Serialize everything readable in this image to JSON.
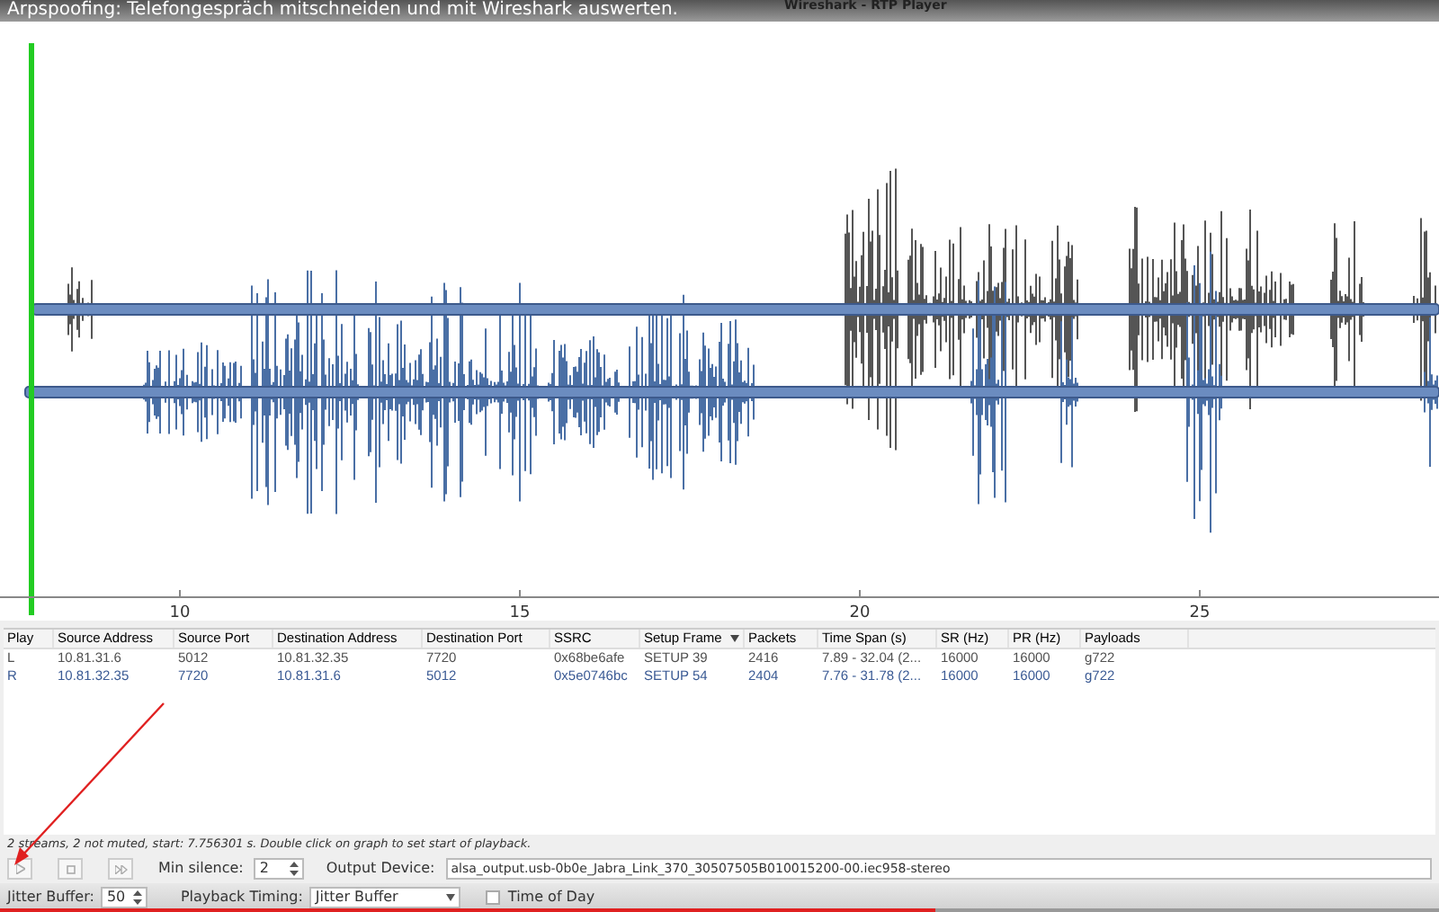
{
  "video": {
    "title": "Arpspoofing: Telefongespräch mitschneiden und mit Wireshark auswerten.",
    "progress": {
      "level": 0.65
    }
  },
  "window": {
    "title": "Wireshark - RTP Player"
  },
  "plot": {
    "axis_ticks": [
      "10",
      "15",
      "20",
      "25"
    ],
    "playhead": {
      "level": 0.02
    }
  },
  "table": {
    "columns": [
      {
        "label": "Play",
        "sorted": false
      },
      {
        "label": "Source Address",
        "sorted": false
      },
      {
        "label": "Source Port",
        "sorted": false
      },
      {
        "label": "Destination Address",
        "sorted": false
      },
      {
        "label": "Destination Port",
        "sorted": false
      },
      {
        "label": "SSRC",
        "sorted": false
      },
      {
        "label": "Setup Frame",
        "sorted": true
      },
      {
        "label": "Packets",
        "sorted": false
      },
      {
        "label": "Time Span (s)",
        "sorted": false
      },
      {
        "label": "SR (Hz)",
        "sorted": false
      },
      {
        "label": "PR (Hz)",
        "sorted": false
      },
      {
        "label": "Payloads",
        "sorted": false
      }
    ],
    "rows": [
      {
        "color": "#505050",
        "cells": [
          "L",
          "10.81.31.6",
          "5012",
          "10.81.32.35",
          "7720",
          "0x68be6afe",
          "SETUP 39",
          "2416",
          "7.89 - 32.04 (2...",
          "16000",
          "16000",
          "g722"
        ]
      },
      {
        "color": "#3a5a94",
        "cells": [
          "R",
          "10.81.32.35",
          "7720",
          "10.81.31.6",
          "5012",
          "0x5e0746bc",
          "SETUP 54",
          "2404",
          "7.76 - 31.78 (2...",
          "16000",
          "16000",
          "g722"
        ]
      }
    ]
  },
  "status": "2 streams, 2 not muted, start: 7.756301 s. Double click on graph to set start of playback.",
  "controls": {
    "min_silence": {
      "label": "Min silence:",
      "value": "2"
    },
    "output_device": {
      "label": "Output Device:",
      "value": "alsa_output.usb-0b0e_Jabra_Link_370_30507505B010015200-00.iec958-stereo"
    },
    "jitter_buffer": {
      "label": "Jitter Buffer:",
      "value": "50"
    },
    "playback_timing": {
      "label": "Playback Timing:",
      "value": "Jitter Buffer"
    },
    "time_of_day": {
      "label": "Time of Day",
      "checked": false
    }
  }
}
